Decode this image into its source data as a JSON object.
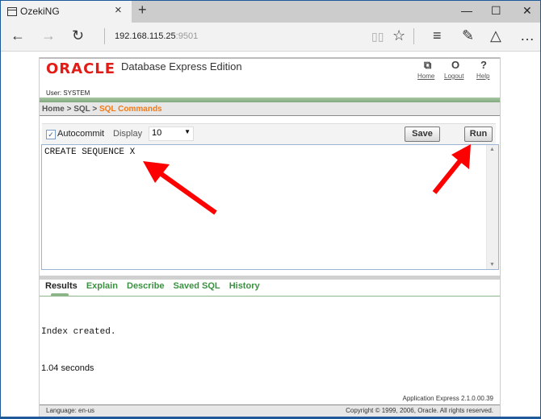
{
  "browser": {
    "tab_title": "OzekiNG",
    "url_host": "192.168.115.25",
    "url_port": ":9501",
    "icons": {
      "tab": "page-icon",
      "close": "×",
      "new_tab": "+",
      "minimize": "—",
      "maximize": "☐",
      "window_close": "✕",
      "back": "←",
      "forward": "→",
      "refresh": "↻",
      "reading_view": "📖",
      "favorite": "☆",
      "hub": "≡",
      "web_note": "✎",
      "share": "△",
      "more": "…"
    }
  },
  "header": {
    "logo": "ORACLE",
    "product": "Database Express Edition",
    "user": "User: SYSTEM",
    "links": [
      {
        "label": "Home",
        "icon": "⧉"
      },
      {
        "label": "Logout",
        "icon": "O"
      },
      {
        "label": "Help",
        "icon": "?"
      }
    ]
  },
  "breadcrumb": {
    "items": [
      "Home",
      "SQL"
    ],
    "separator": " > ",
    "current": "SQL Commands"
  },
  "toolbar": {
    "autocommit_label": "Autocommit",
    "autocommit_checked": true,
    "check_glyph": "✓",
    "display_label": "Display",
    "display_value": "10",
    "dropdown_arrow": "▼",
    "save_label": "Save",
    "run_label": "Run"
  },
  "editor": {
    "sql": "CREATE SEQUENCE X",
    "scroll_up": "▲",
    "scroll_down": "▼"
  },
  "result_tabs": [
    {
      "label": "Results",
      "active": true
    },
    {
      "label": "Explain",
      "active": false
    },
    {
      "label": "Describe",
      "active": false
    },
    {
      "label": "Saved SQL",
      "active": false
    },
    {
      "label": "History",
      "active": false
    }
  ],
  "results": {
    "message": "Index created.",
    "timing": "1.04 seconds"
  },
  "footer": {
    "version": "Application Express 2.1.0.00.39",
    "language": "Language: en-us",
    "copyright": "Copyright © 1999, 2006, Oracle. All rights reserved."
  },
  "colors": {
    "oracle_red": "#e21c16",
    "breadcrumb_current": "#f07a1a",
    "tab_link": "#3b9141",
    "annotation_arrow": "#ff0000"
  }
}
